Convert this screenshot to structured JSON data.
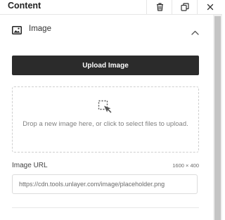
{
  "header": {
    "title": "Content",
    "buttons": [
      {
        "icon": "trash-icon"
      },
      {
        "icon": "duplicate-icon"
      },
      {
        "icon": "close-icon"
      }
    ]
  },
  "section": {
    "icon": "image-icon",
    "label": "Image",
    "toggle_icon": "chevron-up-icon"
  },
  "upload": {
    "button_label": "Upload Image",
    "drop_icon": "drop-select-icon",
    "drop_text": "Drop a new image here, or click to select files to upload."
  },
  "image_url": {
    "label": "Image URL",
    "dimensions": "1600 × 400",
    "value": "https://cdn.tools.unlayer.com/image/placeholder.png"
  },
  "colors": {
    "button_bg": "#2b2b2b",
    "border": "#dcdcdc",
    "scroll_thumb": "#c4c4c4"
  }
}
